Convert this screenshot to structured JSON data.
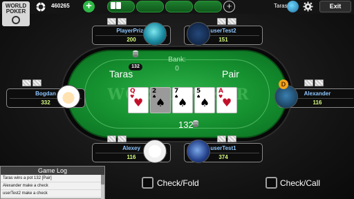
{
  "topbar": {
    "logo_text_top": "WORLD",
    "logo_text_bottom": "POKER",
    "chips_icon": "poker-chip-icon",
    "chips_value": "460265",
    "add_chips_label": "+",
    "add_table_label": "+",
    "user_name": "Taras",
    "settings_icon": "gear-icon",
    "exit_label": "Exit"
  },
  "table": {
    "watermark": "WORLD POKER",
    "bank_label": "Bank:",
    "bank_value": "0",
    "winner_name": "Taras",
    "hand_name": "Pair",
    "player_bet": "132",
    "pot_value": "132"
  },
  "community_cards": [
    {
      "rank": "Q",
      "suit": "♥",
      "red": true,
      "dim": false
    },
    {
      "rank": "2",
      "suit": "♠",
      "red": false,
      "dim": true
    },
    {
      "rank": "7",
      "suit": "♠",
      "red": false,
      "dim": false
    },
    {
      "rank": "5",
      "suit": "♠",
      "red": false,
      "dim": false
    },
    {
      "rank": "A",
      "suit": "♥",
      "red": true,
      "dim": false
    }
  ],
  "seats": {
    "playerprize": {
      "name": "PlayerPrize",
      "chips": "200"
    },
    "usertest2": {
      "name": "userTest2",
      "chips": "151"
    },
    "bogdan": {
      "name": "Bogdan",
      "chips": "332"
    },
    "alexander": {
      "name": "Alexander",
      "chips": "116"
    },
    "alexey": {
      "name": "Alexey",
      "chips": "116"
    },
    "usertest1": {
      "name": "userTest1",
      "chips": "374"
    }
  },
  "dealer_label": "D",
  "gamelog": {
    "title": "Game Log",
    "lines": [
      "Taras  wins a pot  132 [Pair]",
      "Alexander  make a check",
      "userTest2  make a check"
    ]
  },
  "actions": {
    "check_fold": "Check/Fold",
    "check_call": "Check/Call"
  },
  "colors": {
    "felt": "#1a9a35",
    "name": "#8fc7ff",
    "chips": "#d8ff80",
    "add_button": "#2eb845"
  }
}
